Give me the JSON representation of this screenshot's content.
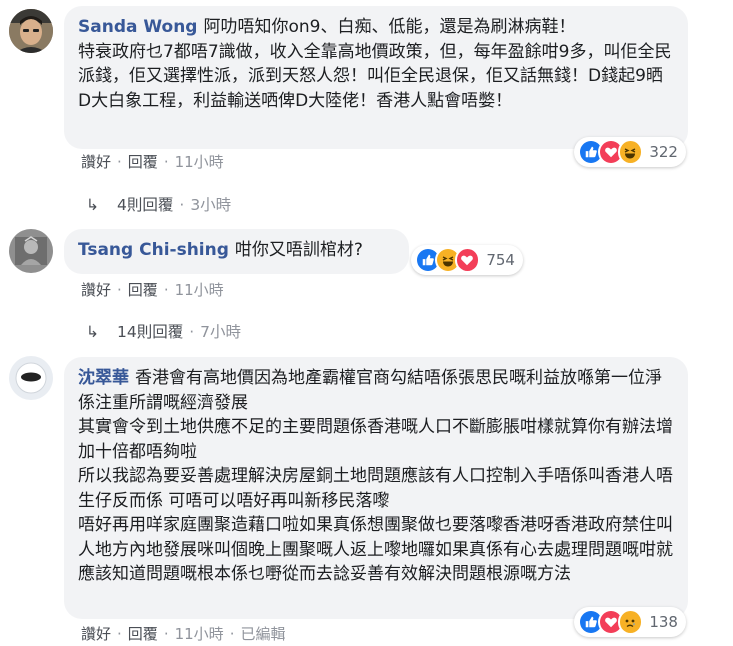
{
  "comments": [
    {
      "author": "Sanda Wong",
      "text": "阿叻唔知你on9、白痴、低能，還是為刷淋病鞋！\n特衰政府乜7都唔7識做，收入全靠高地價政策，但，每年盈餘咁9多，叫佢全民派錢，佢又選擇性派，派到天怒人怨！叫佢全民退保，佢又話無錢！D錢起9晒D大白象工程，利益輸送哂俾D大陸佬！香港人點會唔嫳！",
      "actions": {
        "like": "讚好",
        "reply": "回覆",
        "time": "11小時"
      },
      "reaction_count": "322",
      "reactions": [
        "like-icon",
        "love-icon",
        "haha-icon"
      ],
      "replies": {
        "label": "4則回覆",
        "time": "3小時"
      }
    },
    {
      "author": "Tsang Chi-shing",
      "text": "咁你又唔訓棺材?",
      "actions": {
        "like": "讚好",
        "reply": "回覆",
        "time": "11小時"
      },
      "reaction_count": "754",
      "reactions": [
        "like-icon",
        "haha-icon",
        "love-icon"
      ],
      "replies": {
        "label": "14則回覆",
        "time": "7小時"
      }
    },
    {
      "author": "沈翠華",
      "text": "香港會有高地價因為地產霸權官商勾結唔係張思民嘅利益放喺第一位淨係注重所謂嘅經濟發展\n其實會令到土地供應不足的主要問題係香港嘅人口不斷膨脹咁樣就算你有辦法增加十倍都唔夠啦\n所以我認為要妥善處理解決房屋銅土地問題應該有人口控制入手唔係叫香港人唔生仔反而係 可唔可以唔好再叫新移民落嚟\n唔好再用咩家庭團聚造藉口啦如果真係想團聚做乜要落嚟香港呀香港政府禁住叫人地方內地發展咪叫個晚上團聚嘅人返上嚟地囉如果真係有心去處理問題嘅咁就應該知道問題嘅根本係乜嘢從而去諗妥善有效解決問題根源嘅方法",
      "actions": {
        "like": "讚好",
        "reply": "回覆",
        "time": "11小時",
        "edited": "已編輯"
      },
      "reaction_count": "138",
      "reactions": [
        "like-icon",
        "love-icon",
        "sad-icon"
      ]
    }
  ],
  "colors": {
    "author": "#385898",
    "bubble": "#f2f3f5",
    "like": "#1877f2",
    "love": "#f33e58",
    "haha": "#f7b125"
  }
}
